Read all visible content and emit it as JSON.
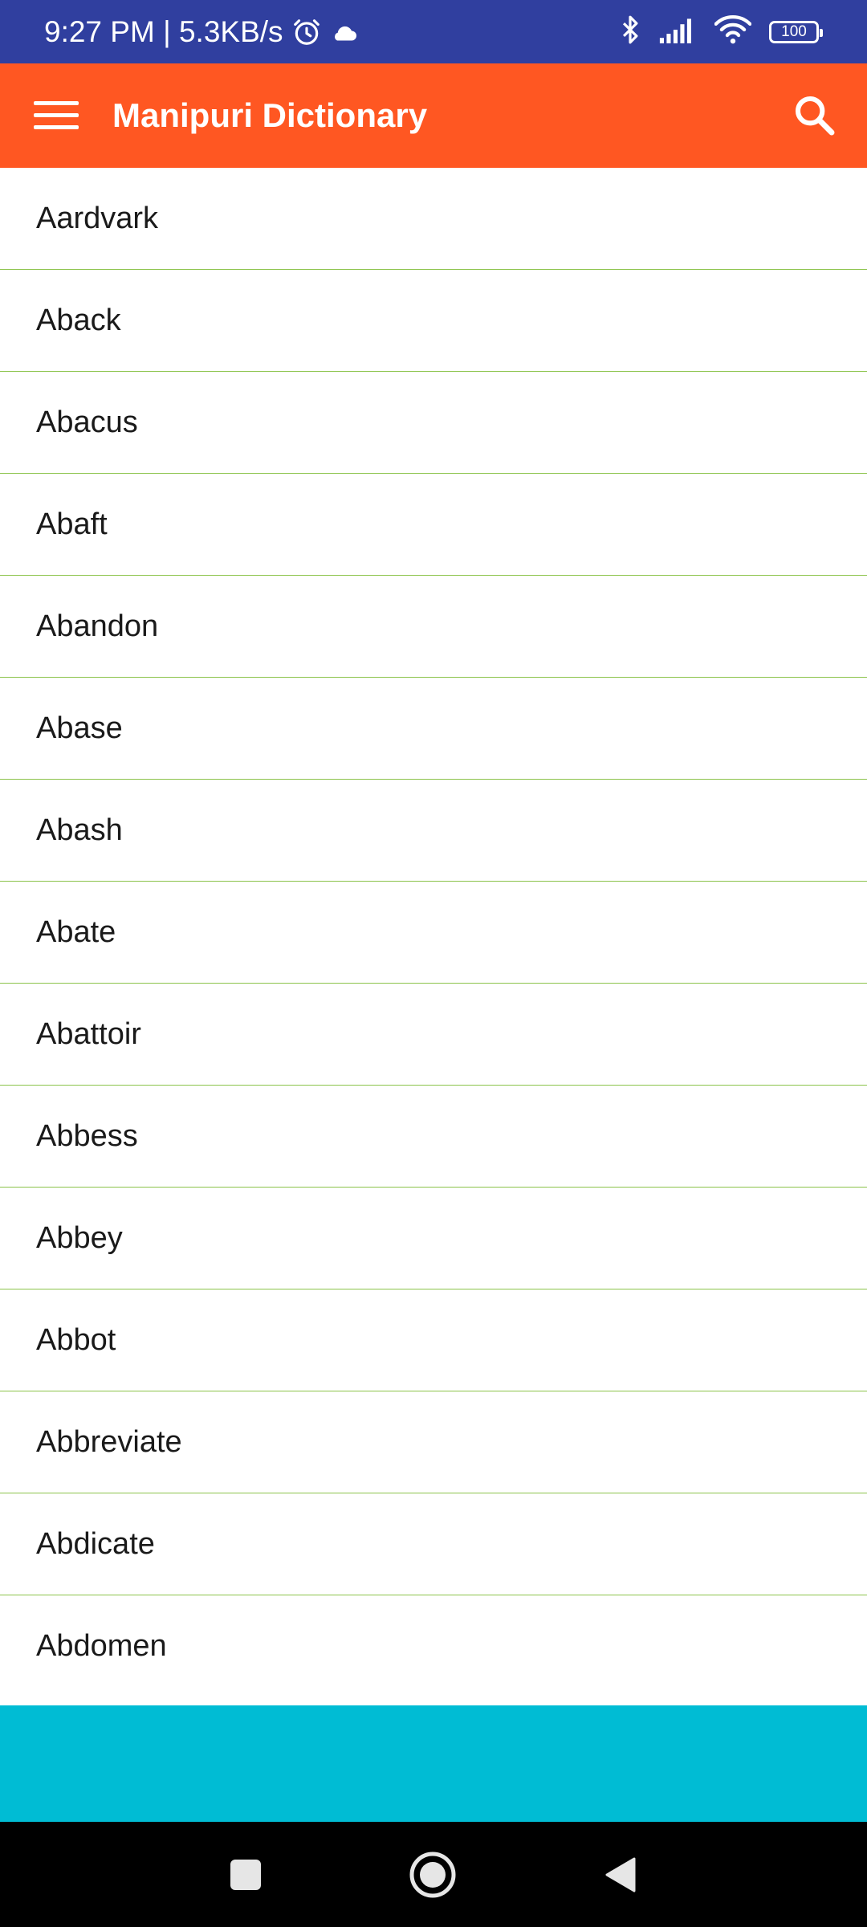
{
  "status_bar": {
    "time_speed": "9:27 PM | 5.3KB/s",
    "battery": "100",
    "icons": [
      "alarm-icon",
      "cloud-icon",
      "bluetooth-icon",
      "signal-icon",
      "wifi-icon",
      "battery-icon"
    ]
  },
  "app_bar": {
    "title": "Manipuri Dictionary",
    "menu_icon": "hamburger-menu-icon",
    "search_icon": "search-icon"
  },
  "words": [
    "Aardvark",
    "Aback",
    "Abacus",
    "Abaft",
    "Abandon",
    "Abase",
    "Abash",
    "Abate",
    "Abattoir",
    "Abbess",
    "Abbey",
    "Abbot",
    "Abbreviate",
    "Abdicate",
    "Abdomen"
  ],
  "nav_bar": {
    "buttons": [
      "recents-square-icon",
      "home-circle-icon",
      "back-triangle-icon"
    ]
  },
  "colors": {
    "status_bar": "#303f9f",
    "app_bar": "#ff5722",
    "divider": "#8bc34a",
    "banner": "#00bcd4",
    "nav_bar": "#000000"
  }
}
